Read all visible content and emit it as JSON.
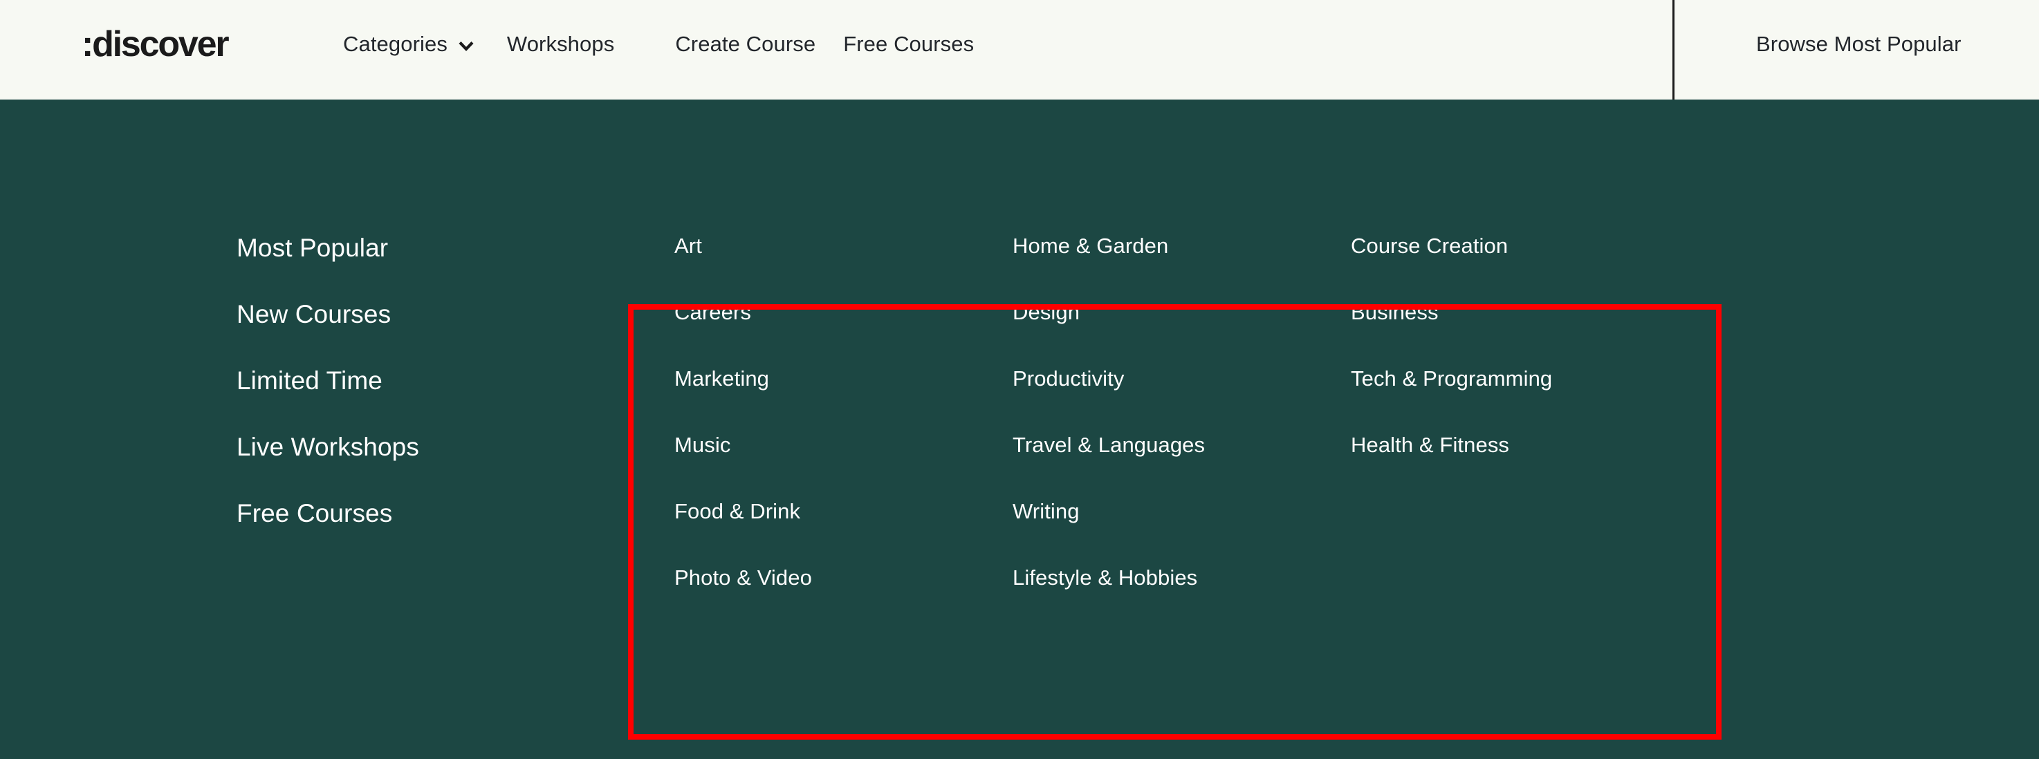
{
  "colors": {
    "header_bg": "#F7F9F3",
    "panel_bg": "#1C4743",
    "text_dark": "#22262B",
    "text_light": "#FFFFFF",
    "highlight": "#FF0000",
    "divider": "#1B1B1B"
  },
  "header": {
    "logo": ":discover",
    "nav": {
      "categories_label": "Categories",
      "chevron_icon": "chevron-down-icon",
      "workshops_label": "Workshops",
      "create_course_label": "Create Course",
      "free_courses_label": "Free Courses"
    },
    "cta_label": "Browse Most Popular"
  },
  "mega_menu": {
    "rail": [
      {
        "label": "Most Popular"
      },
      {
        "label": "New Courses"
      },
      {
        "label": "Limited Time"
      },
      {
        "label": "Live Workshops"
      },
      {
        "label": "Free Courses"
      }
    ],
    "category_columns": [
      {
        "items": [
          {
            "label": "Art"
          },
          {
            "label": "Careers"
          },
          {
            "label": "Marketing"
          },
          {
            "label": "Music"
          },
          {
            "label": "Food & Drink"
          },
          {
            "label": "Photo & Video"
          }
        ]
      },
      {
        "items": [
          {
            "label": "Home & Garden"
          },
          {
            "label": "Design"
          },
          {
            "label": "Productivity"
          },
          {
            "label": "Travel & Languages"
          },
          {
            "label": "Writing"
          },
          {
            "label": "Lifestyle & Hobbies"
          }
        ]
      },
      {
        "items": [
          {
            "label": "Course Creation"
          },
          {
            "label": "Business"
          },
          {
            "label": "Tech & Programming"
          },
          {
            "label": "Health & Fitness"
          }
        ]
      }
    ]
  }
}
